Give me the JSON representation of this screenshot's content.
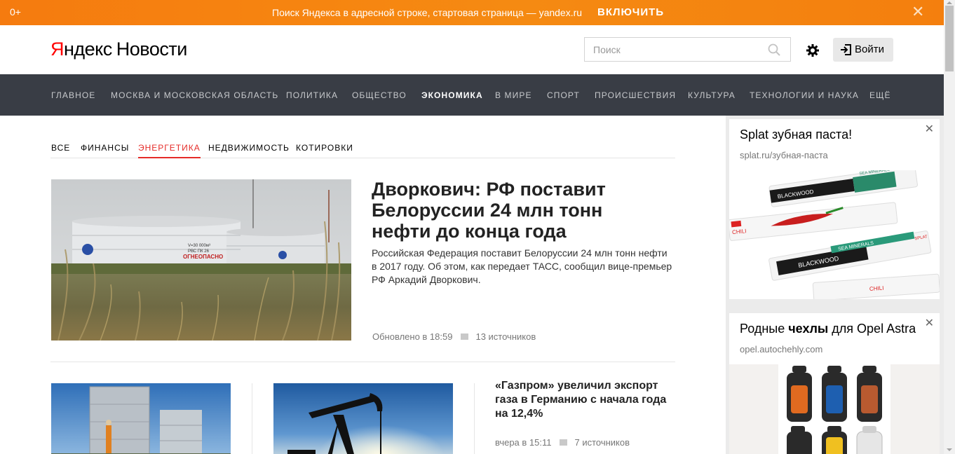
{
  "promo": {
    "age": "0+",
    "message": "Поиск Яндекса в адресной строке, стартовая страница — yandex.ru",
    "enable_label": "ВКЛЮЧИТЬ",
    "close_glyph": "✕"
  },
  "header": {
    "logo_brand_first": "Я",
    "logo_brand_rest": "ндекс",
    "logo_service": "Новости",
    "search_placeholder": "Поиск",
    "login_label": "Войти"
  },
  "nav": {
    "items": [
      "ГЛАВНОЕ",
      "МОСКВА И МОСКОВСКАЯ ОБЛАСТЬ",
      "ПОЛИТИКА",
      "ОБЩЕСТВО",
      "ЭКОНОМИКА",
      "В МИРЕ",
      "СПОРТ",
      "ПРОИСШЕСТВИЯ",
      "КУЛЬТУРА",
      "ТЕХНОЛОГИИ И НАУКА",
      "ЕЩЁ"
    ],
    "active": "ЭКОНОМИКА"
  },
  "subnav": {
    "items": [
      "ВСЕ",
      "ФИНАНСЫ",
      "ЭНЕРГЕТИКА",
      "НЕДВИЖИМОСТЬ",
      "КОТИРОВКИ"
    ],
    "active": "ЭНЕРГЕТИКА"
  },
  "main_story": {
    "title": "Дворкович: РФ поставит Белоруссии 24 млн тонн нефти до конца года",
    "snippet": "Российская Федерация поставит Белоруссии 24 млн тонн нефти в 2017 году. Об этом, как передает ТАСС, сообщил вице-премьер РФ Аркадий Дворкович.",
    "updated": "Обновлено в 18:59",
    "sources": "13 источников",
    "image_text_1": "V=30 000м³",
    "image_text_2": "РВС ПК 26",
    "image_text_3": "ОГНЕОПАСНО"
  },
  "second_story": {
    "title": "«Газпром» увеличил экспорт газа в Германию с начала года на 12,4%",
    "time": "вчера в 15:11",
    "sources": "7 источников"
  },
  "ads": [
    {
      "title": "Splat зубная паста!",
      "url": "splat.ru/зубная-паста",
      "close": "✕",
      "product_brand": "SPLAT",
      "product_line_1": "SEA MINERALS",
      "product_line_2": "BLACKWOOD",
      "product_line_3": "CHILI"
    },
    {
      "title_pre": "Родные ",
      "title_bold": "чехлы",
      "title_mid": " для ",
      "title_post": "Opel Astra",
      "url": "opel.autochehly.com",
      "close": "✕"
    }
  ],
  "colors": {
    "accent_red": "#e52b28",
    "nav_bg": "#393d45",
    "promo_orange": "#f68410"
  }
}
